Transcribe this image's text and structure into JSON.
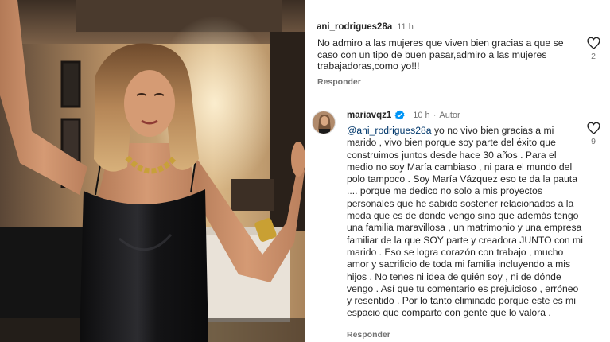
{
  "comments": [
    {
      "username": "ani_rodrigues28a",
      "time": "11 h",
      "text": "No admiro a las mujeres que viven bien gracias a que se caso con un tipo de buen pasar,admiro a las mujeres trabajadoras,como yo!!!",
      "reply_label": "Responder",
      "likes": "2"
    },
    {
      "username": "mariavqz1",
      "time": "10 h",
      "separator": "·",
      "author_label": "Autor",
      "mention": "@ani_rodrigues28a",
      "text": " yo no vivo bien gracias a mi marido , vivo bien porque soy parte del éxito que construimos juntos  desde hace 30 años . Para el medio no soy María cambiaso , ni para el mundo del polo tampoco . Soy María Vázquez  eso te da la pauta .... porque me dedico no solo a mis proyectos personales que he sabido sostener relacionados a la moda que es de donde vengo sino que además tengo una familia maravillosa , un matrimonio y una empresa familiar de la que SOY parte y creadora JUNTO con mi marido . Eso se logra corazón con trabajo , mucho amor y sacrificio de toda mi familia incluyendo a mis hijos . No tenes ni idea de quién soy , ni de dónde vengo . Así que tu comentario es prejuicioso , erróneo y resentido . Por lo tanto eliminado porque este es mi espacio que comparto con gente que lo valora .",
      "reply_label": "Responder",
      "likes": "9"
    }
  ],
  "icons": {
    "like": "heart-icon",
    "verified": "verified-badge-icon"
  },
  "colors": {
    "verified_blue": "#0095f6",
    "mention_blue": "#00376b",
    "muted_text": "#737373"
  }
}
